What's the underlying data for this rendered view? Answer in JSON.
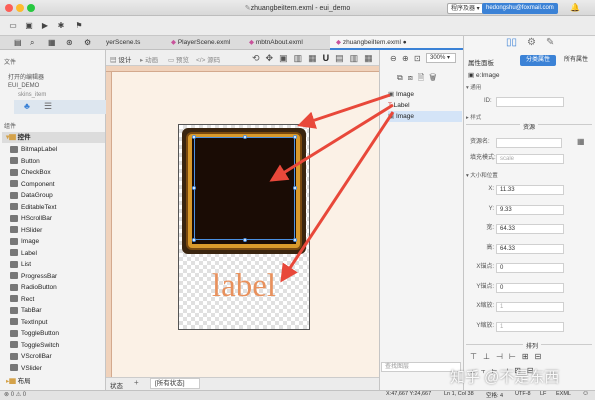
{
  "window": {
    "title": "zhuangbeiItem.exml - eui_demo",
    "runtime_select": "程序及器",
    "user_email": "hedongshu@foxmail.com"
  },
  "tabs": [
    {
      "label": "yerScene.ts"
    },
    {
      "label": "PlayerScene.exml"
    },
    {
      "label": "mbtnAbout.exml"
    },
    {
      "label": "zhuangbeiItem.exml"
    }
  ],
  "left_panel": {
    "files_title": "文件",
    "open_editors": "打开的编辑器",
    "project": "EUI_DEMO",
    "skins_item": "skins_item",
    "components_title": "组件",
    "controls_group": "控件",
    "controls": [
      "BitmapLabel",
      "Button",
      "CheckBox",
      "Component",
      "DataGroup",
      "EditableText",
      "HScrollBar",
      "HSlider",
      "Image",
      "Label",
      "List",
      "ProgressBar",
      "RadioButton",
      "Rect",
      "TabBar",
      "TextInput",
      "ToggleButton",
      "ToggleSwitch",
      "VScrollBar",
      "VSlider"
    ],
    "layout_group": "布局"
  },
  "center": {
    "toolbar": [
      "设计",
      "动画",
      "预览",
      "源码"
    ],
    "zoom": "300%",
    "stage_label": "label",
    "bottom_state": "状态",
    "bottom_all": "[所有状态]"
  },
  "layers": {
    "items": [
      {
        "label": "Image"
      },
      {
        "label": "Label"
      },
      {
        "label": "Image"
      }
    ],
    "search_placeholder": "查找图层"
  },
  "props": {
    "title": "属性面板",
    "tab_category": "分类属性",
    "tab_all": "所有属性",
    "element": "e:Image",
    "common": "通用",
    "id_label": "ID:",
    "style": "样式",
    "resource_section": "资源",
    "source_label": "资源名:",
    "fill_label": "填充模式:",
    "fill_value": "scale",
    "size_section": "大小和位置",
    "rows": [
      {
        "label": "X:",
        "value": "11.33"
      },
      {
        "label": "Y:",
        "value": "9.33"
      },
      {
        "label": "宽:",
        "value": "64.33"
      },
      {
        "label": "高:",
        "value": "64.33"
      },
      {
        "label": "X锚点:",
        "value": "0"
      },
      {
        "label": "Y锚点:",
        "value": "0"
      },
      {
        "label": "X缩放:",
        "value": "1"
      },
      {
        "label": "Y缩放:",
        "value": "1"
      }
    ],
    "arrange_section": "排列"
  },
  "status": {
    "coords": "X:47,667 Y:24,667",
    "line_col": "Ln 1, Col 38",
    "spaces": "空格: 4",
    "encoding": "UTF-8",
    "eol": "LF",
    "lang": "EXML"
  },
  "watermark": "知乎 @不是东西",
  "colors": {
    "accent": "#3b82d6",
    "arrow": "#e8483a",
    "label": "#e8915d"
  }
}
